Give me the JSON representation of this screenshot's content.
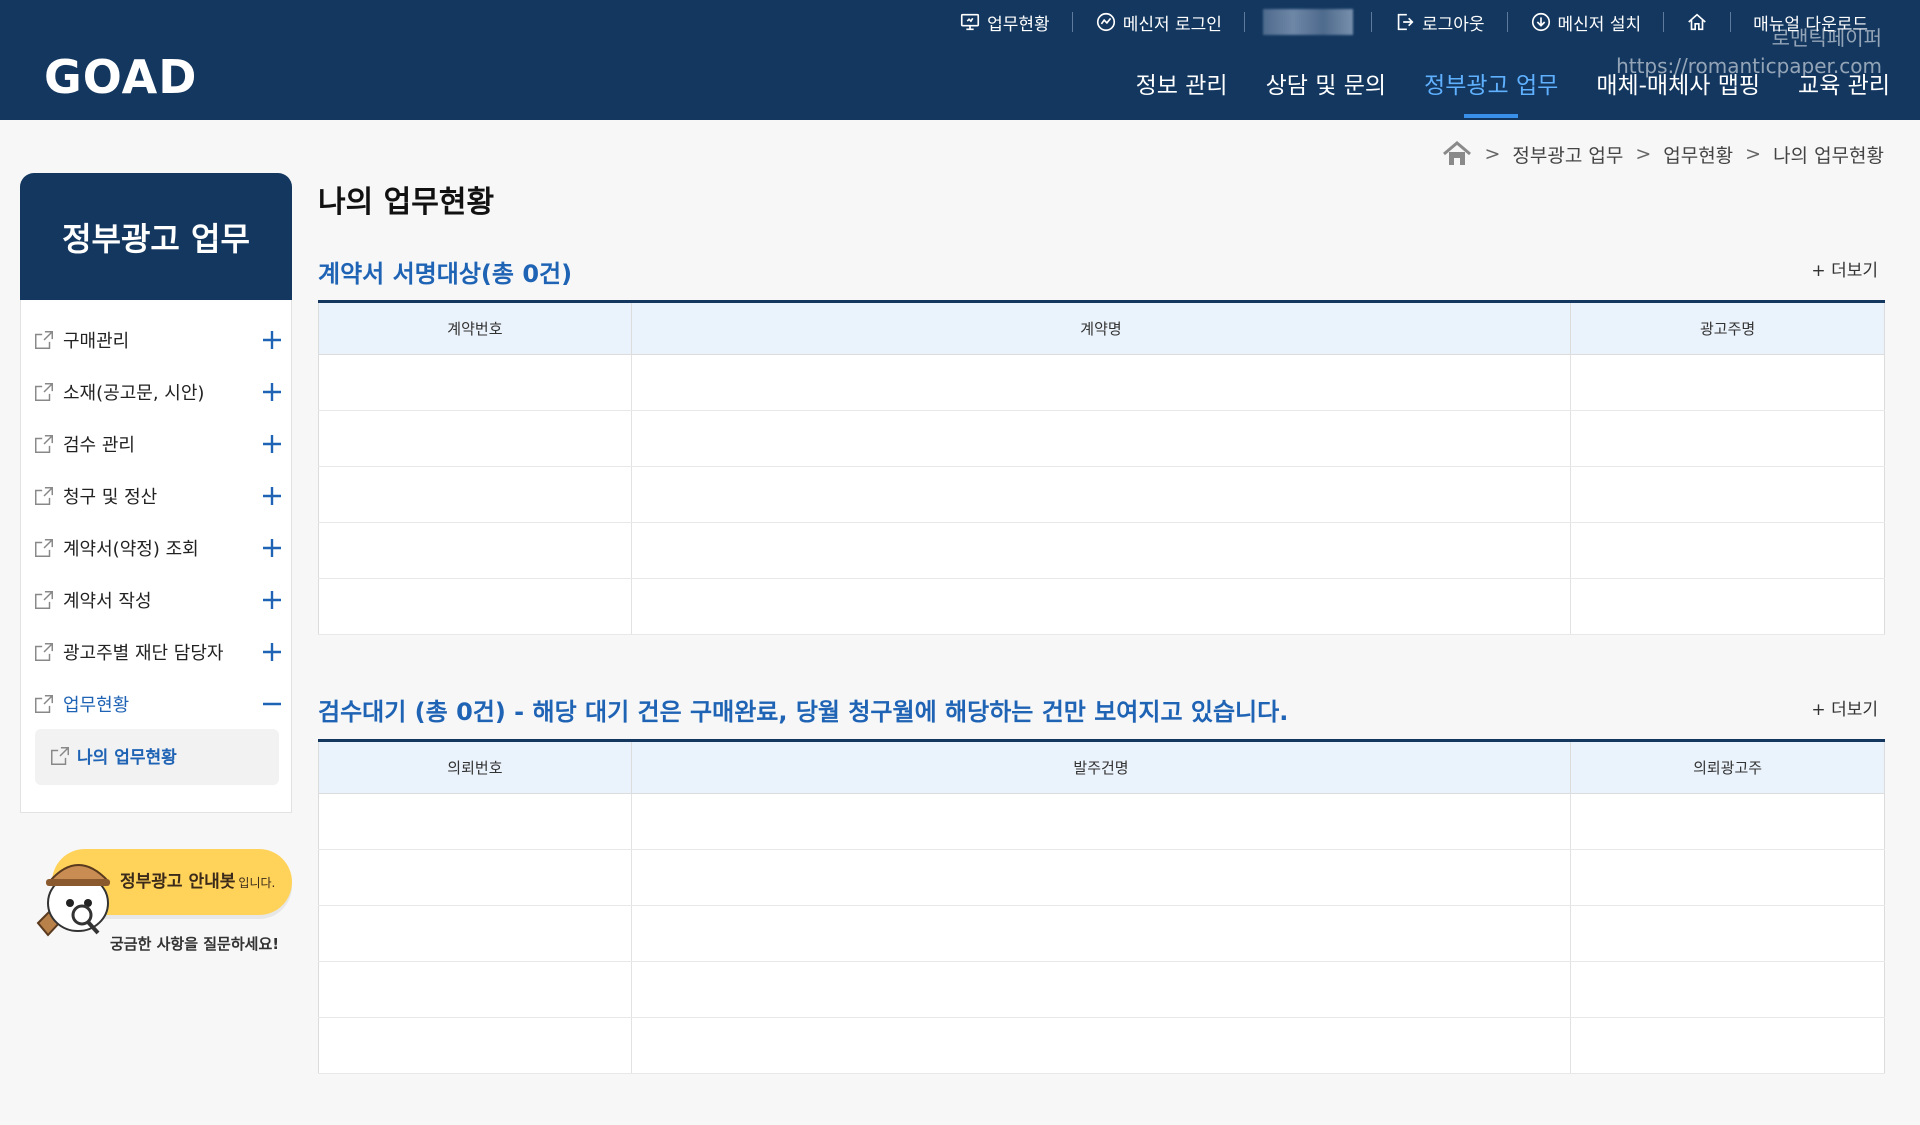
{
  "header": {
    "logo": "GOAD",
    "util": {
      "work_status": "업무현황",
      "messenger_login": "메신저 로그인",
      "logout": "로그아웃",
      "messenger_install": "메신저 설치",
      "manual_download": "매뉴얼 다운로드"
    },
    "watermark": {
      "line1": "로맨틱페이퍼",
      "line2": "https://romanticpaper.com"
    },
    "nav": [
      "정보 관리",
      "상담 및 문의",
      "정부광고 업무",
      "매체-매체사 맵핑",
      "교육 관리"
    ],
    "nav_active_index": 2
  },
  "sidebar": {
    "title": "정부광고 업무",
    "items": [
      {
        "label": "구매관리",
        "state": "plus"
      },
      {
        "label": "소재(공고문, 시안)",
        "state": "plus"
      },
      {
        "label": "검수 관리",
        "state": "plus"
      },
      {
        "label": "청구 및 정산",
        "state": "plus"
      },
      {
        "label": "계약서(약정) 조회",
        "state": "plus"
      },
      {
        "label": "계약서 작성",
        "state": "plus"
      },
      {
        "label": "광고주별 재단 담당자",
        "state": "plus"
      },
      {
        "label": "업무현황",
        "state": "minus"
      }
    ],
    "sub_item": "나의 업무현황",
    "chatbot": {
      "title": "정부광고 안내봇",
      "title_suffix": "입니다.",
      "subtitle": "궁금한 사항을 질문하세요!"
    }
  },
  "breadcrumb": [
    "정부광고 업무",
    "업무현황",
    "나의 업무현황"
  ],
  "main": {
    "page_title": "나의 업무현황",
    "section1": {
      "title": "계약서 서명대상(총 0건)",
      "more": "+ 더보기",
      "columns": [
        "계약번호",
        "계약명",
        "광고주명"
      ]
    },
    "section2": {
      "title": "검수대기 (총 0건) - 해당 대기 건은 구매완료, 당월 청구월에 해당하는 건만 보여지고 있습니다.",
      "more": "+ 더보기",
      "columns": [
        "의뢰번호",
        "발주건명",
        "의뢰광고주"
      ]
    }
  },
  "colors": {
    "header_bg": "#13375f",
    "accent_blue": "#1f63b5",
    "nav_active": "#5fb0ff",
    "table_head_bg": "#eaf2fb",
    "chatbot_yellow": "#ffd25a"
  }
}
